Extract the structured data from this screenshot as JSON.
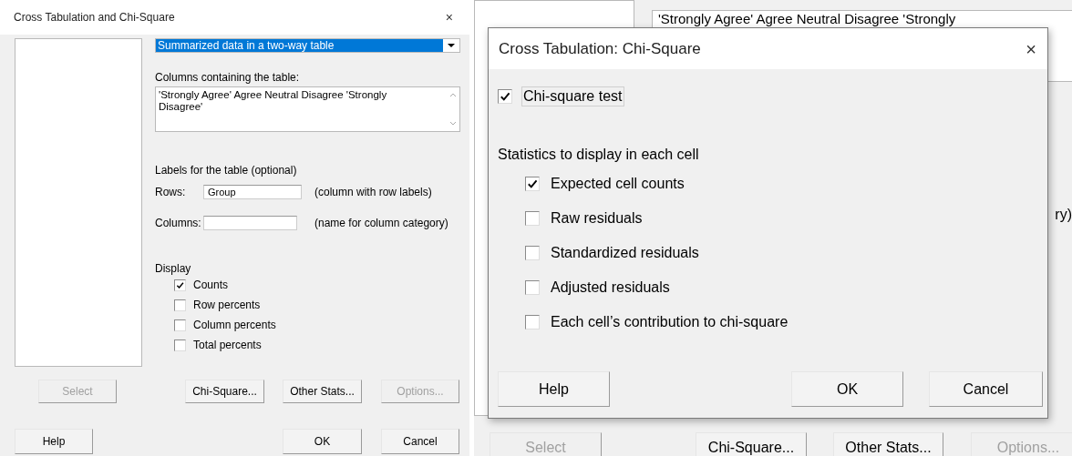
{
  "main_dialog": {
    "title": "Cross Tabulation and Chi-Square",
    "close": "×",
    "data_format": {
      "value": "Summarized data in a two-way table",
      "highlighted": true
    },
    "columns_label": "Columns containing the table:",
    "columns_value": "'Strongly Agree' Agree Neutral Disagree 'Strongly Disagree'",
    "labels_heading": "Labels for the table (optional)",
    "rows_label": "Rows:",
    "rows_value": "Group",
    "rows_hint": "(column with row labels)",
    "columns_field_label": "Columns:",
    "columns_hint": "(name for column category)",
    "display_heading": "Display",
    "display_options": [
      {
        "label": "Counts",
        "checked": true
      },
      {
        "label": "Row percents",
        "checked": false
      },
      {
        "label": "Column percents",
        "checked": false
      },
      {
        "label": "Total percents",
        "checked": false
      }
    ],
    "buttons": [
      {
        "label": "Select",
        "disabled": true
      },
      {
        "label": "Chi-Square...",
        "disabled": false
      },
      {
        "label": "Other Stats...",
        "disabled": false
      },
      {
        "label": "Options...",
        "disabled": true
      }
    ],
    "footer_buttons": [
      {
        "label": "Help",
        "disabled": false
      },
      {
        "label": "OK",
        "disabled": false
      },
      {
        "label": "Cancel",
        "disabled": false
      }
    ]
  },
  "background_dialog": {
    "columns_value": "'Strongly Agree' Agree Neutral Disagree 'Strongly",
    "columns_hint": "ry)",
    "buttons": [
      {
        "label": "Select",
        "disabled": true
      },
      {
        "label": "Chi-Square...",
        "disabled": false
      },
      {
        "label": "Other Stats...",
        "disabled": false
      },
      {
        "label": "Options...",
        "disabled": true
      }
    ]
  },
  "chi_square_dialog": {
    "title": "Cross Tabulation: Chi-Square",
    "close": "×",
    "test": {
      "label": "Chi-square test",
      "checked": true
    },
    "stats_heading": "Statistics to display in each cell",
    "stats": [
      {
        "label": "Expected cell counts",
        "checked": true
      },
      {
        "label": "Raw residuals",
        "checked": false
      },
      {
        "label": "Standardized residuals",
        "checked": false
      },
      {
        "label": "Adjusted residuals",
        "checked": false
      },
      {
        "label": "Each cell’s contribution to chi-square",
        "checked": false
      }
    ],
    "buttons": [
      {
        "label": "Help",
        "disabled": false
      },
      {
        "label": "OK",
        "disabled": false
      },
      {
        "label": "Cancel",
        "disabled": false
      }
    ]
  }
}
